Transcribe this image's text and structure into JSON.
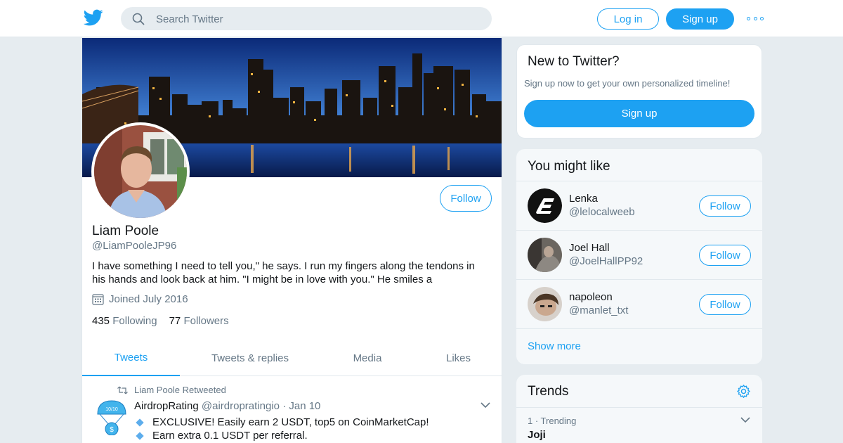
{
  "topbar": {
    "search_placeholder": "Search Twitter",
    "login_label": "Log in",
    "signup_label": "Sign up",
    "logo_icon": "twitter-bird-icon",
    "more_icon": "more-dots-icon"
  },
  "profile": {
    "name": "Liam Poole",
    "handle": "@LiamPooleJP96",
    "follow_label": "Follow",
    "bio": "I have something I need to tell you,\" he says. I run my fingers along the tendons in his hands and look back at him. \"I might be in love with you.\" He smiles a",
    "joined": "Joined July 2016",
    "following_count": "435",
    "following_label": "Following",
    "followers_count": "77",
    "followers_label": "Followers",
    "tabs": [
      {
        "label": "Tweets",
        "active": true
      },
      {
        "label": "Tweets & replies",
        "active": false
      },
      {
        "label": "Media",
        "active": false
      },
      {
        "label": "Likes",
        "active": false
      }
    ]
  },
  "tweet": {
    "retweeted_by": "Liam Poole Retweeted",
    "author_name": "AirdropRating",
    "author_handle": "@airdropratingio",
    "separator": "·",
    "date": "Jan 10",
    "avatar_text": "10/10",
    "lines": [
      "EXCLUSIVE! Easily earn 2 USDT, top5 on CoinMarketCap!",
      "Earn extra 0.1 USDT per referral."
    ]
  },
  "new_to_twitter": {
    "heading": "New to Twitter?",
    "subtitle": "Sign up now to get your own personalized timeline!",
    "signup_label": "Sign up"
  },
  "you_might_like": {
    "heading": "You might like",
    "users": [
      {
        "name": "Lenka",
        "handle": "@lelocalweeb",
        "follow_label": "Follow"
      },
      {
        "name": "Joel Hall",
        "handle": "@JoelHallPP92",
        "follow_label": "Follow"
      },
      {
        "name": "napoleon",
        "handle": "@manlet_txt",
        "follow_label": "Follow"
      }
    ],
    "show_more": "Show more"
  },
  "trends": {
    "heading": "Trends",
    "items": [
      {
        "meta": "1 · Trending",
        "name": "Joji"
      }
    ]
  },
  "colors": {
    "accent": "#1da1f2",
    "background": "#e6ecf0",
    "text_primary": "#14171a",
    "text_secondary": "#657786"
  }
}
